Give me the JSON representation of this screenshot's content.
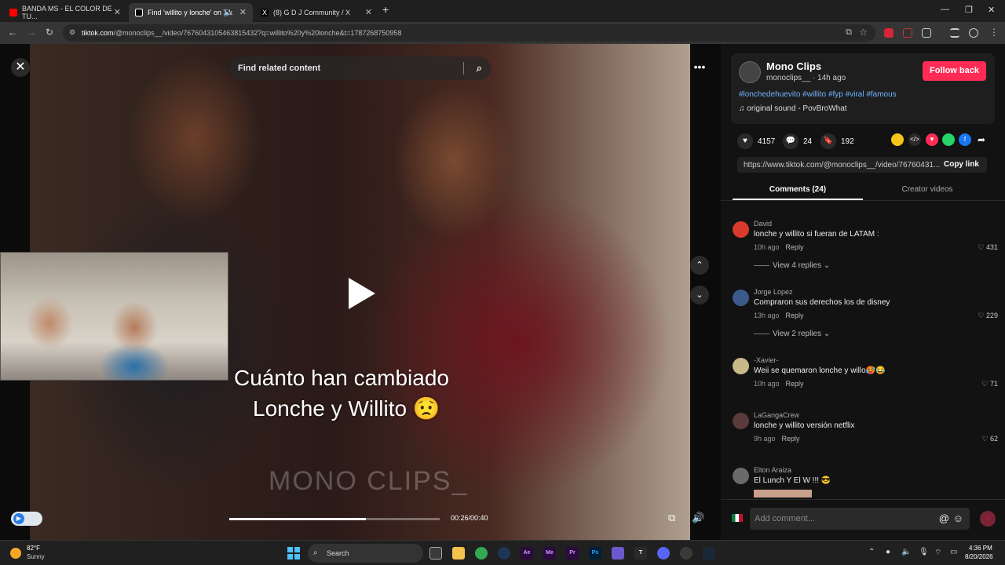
{
  "browser": {
    "tabs": [
      {
        "title": "BANDA MS - EL COLOR DE TU...",
        "icon": "youtube-icon",
        "color": "#ff0000"
      },
      {
        "title": "Find 'willito y lonche' on Tik",
        "icon": "tiktok-icon",
        "color": "#ffffff"
      },
      {
        "title": "(8) G D J Community / X",
        "icon": "x-icon",
        "color": "#ffffff"
      }
    ],
    "url_host": "tiktok.com",
    "url_path": "/@monoclips__/video/7676043105463815432?q=willito%20y%20lonche&t=1787268750958"
  },
  "player": {
    "search_placeholder": "Find related content",
    "caption_line1": "Cuánto han cambiado",
    "caption_line2": "Lonche y Willito 😟",
    "watermark": "MONO CLIPS_",
    "time": "00:26/00:40",
    "progress": 0.65
  },
  "author": {
    "name": "Mono Clips",
    "handle": "monoclips__",
    "age": " · 14h ago",
    "follow_label": "Follow back",
    "hashtags": "#lonchedehuevito #willito #fyp #viral #famous",
    "sound": "♫  original sound - PovBroWhat"
  },
  "stats": {
    "likes": "4157",
    "comments": "24",
    "saves": "192"
  },
  "link": {
    "url": "https://www.tiktok.com/@monoclips__/video/76760431...",
    "copy_label": "Copy link"
  },
  "tabs": {
    "comments": "Comments (24)",
    "creator": "Creator videos"
  },
  "comments": [
    {
      "user": "David",
      "text": "lonche y willito si fueran de LATAM :",
      "time": "10h ago",
      "reply": "Reply",
      "likes": "431",
      "replies": "View 4 replies",
      "avatar_color": "#d93a2b"
    },
    {
      "user": "Jorge Lopez",
      "text": "Compraron sus derechos los de disney",
      "time": "13h ago",
      "reply": "Reply",
      "likes": "229",
      "replies": "View 2 replies",
      "avatar_color": "#3b5a8a"
    },
    {
      "user": "-Xavier-",
      "text": "Weii se quemaron lonche y willo🥵😂",
      "time": "10h ago",
      "reply": "Reply",
      "likes": "71",
      "replies": "",
      "avatar_color": "#c9b98a"
    },
    {
      "user": "LaGangaCrew",
      "text": "lonche y willito versión netflix",
      "time": "9h ago",
      "reply": "Reply",
      "likes": "62",
      "replies": "",
      "avatar_color": "#5a3a3a"
    },
    {
      "user": "Elton Araiza",
      "text": "El Lunch Y El W !!! 😎",
      "time": "",
      "reply": "",
      "likes": "",
      "replies": "",
      "avatar_color": "#6a6a6a"
    }
  ],
  "comment_input": {
    "placeholder": "Add comment..."
  },
  "taskbar": {
    "temp": "82°F",
    "weather": "Sunny",
    "search": "Search",
    "time": "4:36 PM",
    "date": "8/20/2026"
  }
}
